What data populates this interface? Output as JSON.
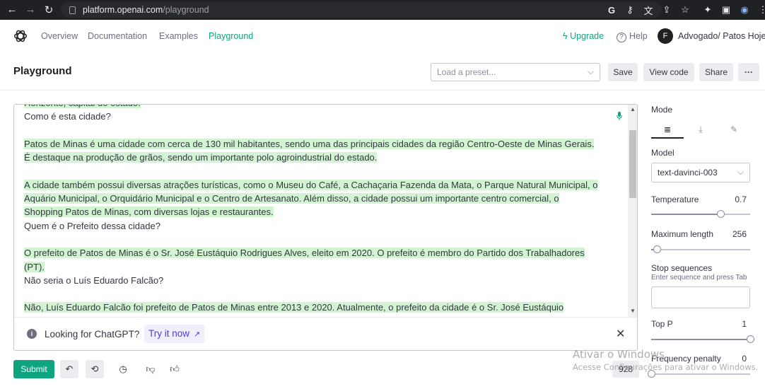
{
  "browser": {
    "url_host": "platform.openai.com",
    "url_path": "/playground"
  },
  "nav": {
    "links": [
      "Overview",
      "Documentation",
      "Examples",
      "Playground"
    ],
    "upgrade_label": "Upgrade",
    "help_label": "Help",
    "avatar_initial": "F",
    "org_name": "Advogado/ Patos Hoje"
  },
  "header": {
    "title": "Playground",
    "preset_placeholder": "Load a preset...",
    "save_label": "Save",
    "view_code_label": "View code",
    "share_label": "Share",
    "more_label": "···"
  },
  "editor": {
    "lines": [
      {
        "text": "Horizonte, capital do estado.",
        "hl": true
      },
      {
        "text": "Como é esta cidade?",
        "hl": false
      },
      {
        "text": "",
        "hl": false
      },
      {
        "text": "Patos de Minas é uma cidade com cerca de 130 mil habitantes, sendo uma das principais cidades da região Centro-Oeste de Minas Gerais.",
        "hl": true
      },
      {
        "text": "É destaque na produção de grãos, sendo um importante polo agroindustrial do estado.",
        "hl": true
      },
      {
        "text": "",
        "hl": false
      },
      {
        "text": "A cidade também possui diversas atrações turísticas, como o Museu do Café, a Cachaçaria Fazenda da Mata, o Parque Natural Municipal, o",
        "hl": true
      },
      {
        "text": " Aquário Municipal, o Orquidário Municipal e o Centro de Artesanato. Além disso, a cidade possui um importante centro comercial, o",
        "hl": true
      },
      {
        "text": "Shopping Patos de Minas, com diversas lojas e restaurantes.",
        "hl": true
      },
      {
        "text": "Quem é o Prefeito dessa cidade?",
        "hl": false
      },
      {
        "text": "",
        "hl": false
      },
      {
        "text": "O prefeito de Patos de Minas é o Sr. José Eustáquio Rodrigues Alves, eleito em 2020. O prefeito é membro do Partido dos Trabalhadores",
        "hl": true
      },
      {
        "text": "(PT).",
        "hl": true
      },
      {
        "text": "Não seria o Luís Eduardo Falcão?",
        "hl": false
      },
      {
        "text": "",
        "hl": false
      },
      {
        "text": "Não, Luís Eduardo Falcão foi prefeito de Patos de Minas entre 2013 e 2020. Atualmente, o prefeito da cidade é o Sr. José Eustáquio",
        "hl": true
      }
    ]
  },
  "banner": {
    "text": "Looking for ChatGPT?",
    "link_label": "Try it now"
  },
  "toolbar": {
    "submit_label": "Submit",
    "token_count": "928"
  },
  "panel": {
    "mode_label": "Mode",
    "model_label": "Model",
    "model_value": "text-davinci-003",
    "temperature_label": "Temperature",
    "temperature_value": "0.7",
    "temperature_level": 0.7,
    "max_length_label": "Maximum length",
    "max_length_value": "256",
    "max_length_level": 0.06,
    "stop_label": "Stop sequences",
    "stop_hint": "Enter sequence and press Tab",
    "top_p_label": "Top P",
    "top_p_value": "1",
    "top_p_level": 1.0,
    "freq_label": "Frequency penalty",
    "freq_value": "0"
  },
  "watermark": {
    "line1": "Ativar o Windows",
    "line2": "Acesse Configurações para ativar o Windows."
  },
  "colors": {
    "accent": "#10a37f",
    "highlight": "#d2f4d3",
    "link": "#5436da"
  }
}
